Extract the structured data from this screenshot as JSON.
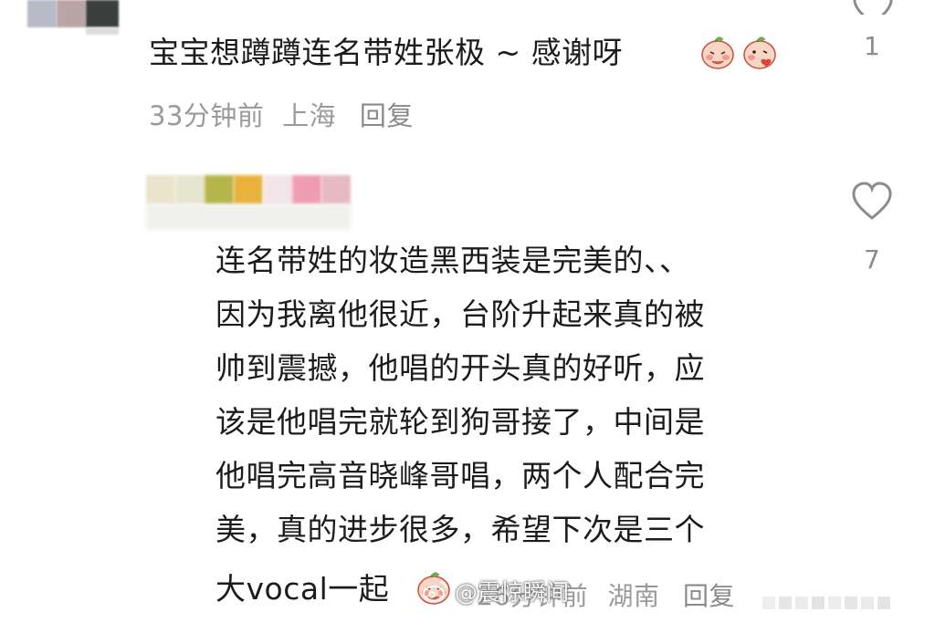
{
  "comments": [
    {
      "text": "宝宝想蹲蹲连名带姓张极 ~ 感谢呀",
      "stickers": [
        "shy-peach-sticker",
        "kiss-peach-sticker"
      ],
      "time": "33分钟前",
      "location": "上海",
      "reply_label": "回复",
      "like_count": "1"
    },
    {
      "lines": [
        "连名带姓的妆造黑西装是完美的、、",
        "因为我离他很近，台阶升起来真的被",
        "帅到震撼，他唱的开头真的好听，应",
        "该是他唱完就轮到狗哥接了，中间是",
        "他唱完高音晓峰哥唱，两个人配合完",
        "美，真的进步很多，希望下次是三个",
        "大vocal一起"
      ],
      "sticker": "shy-peach-sticker",
      "time": "26分钟前",
      "location": "湖南",
      "reply_label": "回复",
      "like_count": "7"
    }
  ],
  "watermark": {
    "text": "@震惊瞬间"
  },
  "colors": {
    "text": "#1c1c1c",
    "meta": "#9a9a9a",
    "heart": "#8c8c8c"
  }
}
